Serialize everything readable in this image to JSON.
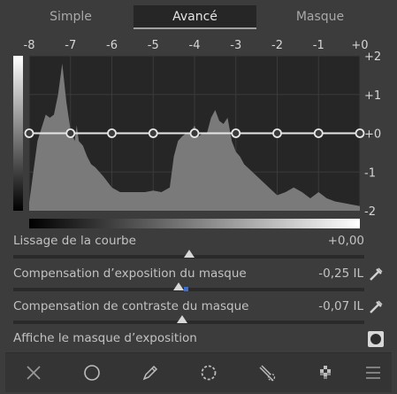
{
  "tabs": [
    {
      "label": "Simple",
      "active": false
    },
    {
      "label": "Avancé",
      "active": true
    },
    {
      "label": "Masque",
      "active": false
    }
  ],
  "graph": {
    "x_ticks": [
      "-8",
      "-7",
      "-6",
      "-5",
      "-4",
      "-3",
      "-2",
      "-1",
      "+0"
    ],
    "y_ticks": [
      "+2",
      "+1",
      "+0",
      "-1",
      "-2"
    ],
    "curve_points_count": 9
  },
  "chart_data": {
    "type": "area",
    "x": [
      -8,
      -7.8,
      -7.6,
      -7.5,
      -7.4,
      -7.3,
      -7.2,
      -7.1,
      -7.0,
      -6.9,
      -6.85,
      -6.8,
      -6.7,
      -6.6,
      -6.5,
      -6.4,
      -6.2,
      -6.0,
      -5.8,
      -5.6,
      -5.4,
      -5.2,
      -5.0,
      -4.8,
      -4.6,
      -4.5,
      -4.4,
      -4.3,
      -4.2,
      -4.1,
      -4.0,
      -3.9,
      -3.8,
      -3.7,
      -3.6,
      -3.5,
      -3.4,
      -3.3,
      -3.2,
      -3.1,
      -3.0,
      -2.9,
      -2.8,
      -2.6,
      -2.4,
      -2.2,
      -2.0,
      -1.8,
      -1.6,
      -1.4,
      -1.2,
      -1.0,
      -0.8,
      -0.6,
      -0.4,
      -0.2,
      0
    ],
    "y": [
      0.05,
      0.45,
      0.62,
      0.6,
      0.62,
      0.75,
      0.95,
      0.7,
      0.52,
      0.45,
      0.55,
      0.45,
      0.42,
      0.35,
      0.3,
      0.28,
      0.22,
      0.15,
      0.12,
      0.12,
      0.12,
      0.12,
      0.13,
      0.12,
      0.15,
      0.35,
      0.45,
      0.48,
      0.5,
      0.5,
      0.55,
      0.48,
      0.5,
      0.5,
      0.6,
      0.65,
      0.58,
      0.56,
      0.6,
      0.45,
      0.38,
      0.35,
      0.3,
      0.25,
      0.2,
      0.15,
      0.1,
      0.12,
      0.15,
      0.12,
      0.08,
      0.12,
      0.08,
      0.06,
      0.05,
      0.04,
      0.03
    ],
    "curve": [
      {
        "x": -8,
        "y": 0
      },
      {
        "x": -7,
        "y": 0
      },
      {
        "x": -6,
        "y": 0
      },
      {
        "x": -5,
        "y": 0
      },
      {
        "x": -4,
        "y": 0
      },
      {
        "x": -3,
        "y": 0
      },
      {
        "x": -2,
        "y": 0
      },
      {
        "x": -1,
        "y": 0
      },
      {
        "x": 0,
        "y": 0
      }
    ],
    "xlim": [
      -8,
      0
    ],
    "ylim": [
      -2,
      2
    ],
    "grid": true,
    "title": "",
    "xlabel": "",
    "ylabel": ""
  },
  "sliders": [
    {
      "label": "Lissage de la courbe",
      "value": "+0,00",
      "fraction": 0.5,
      "picker": false
    },
    {
      "label": "Compensation d’exposition du masque",
      "value": "-0,25 IL",
      "fraction": 0.47,
      "picker": true
    },
    {
      "label": "Compensation de contraste du masque",
      "value": "-0,07 IL",
      "fraction": 0.48,
      "picker": true
    }
  ],
  "toggle": {
    "label": "Affiche le masque d’exposition"
  },
  "toolbar": {
    "tools": [
      "close-icon",
      "circle-icon",
      "pencil-icon",
      "dotted-circle-icon",
      "path-tool-icon",
      "checker-icon",
      "menu-icon"
    ]
  },
  "colors": {
    "background": "#3c3c3c",
    "graph_bg": "#262626",
    "histogram_fill": "#7a7a7a",
    "curve": "#e6e6e6",
    "accent_dot": "#3b6fd6"
  }
}
